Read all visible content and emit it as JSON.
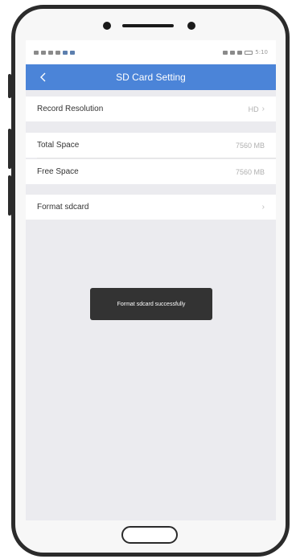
{
  "status_bar": {
    "time": "5:10"
  },
  "header": {
    "title": "SD Card Setting"
  },
  "settings": {
    "record_resolution": {
      "label": "Record Resolution",
      "value": "HD"
    },
    "total_space": {
      "label": "Total Space",
      "value": "7560 MB"
    },
    "free_space": {
      "label": "Free Space",
      "value": "7560 MB"
    },
    "format_sdcard": {
      "label": "Format sdcard"
    }
  },
  "toast": {
    "message": "Format sdcard successfully"
  },
  "icons": {
    "back": "chevron-left-icon",
    "chevron": "chevron-right-icon"
  },
  "colors": {
    "header": "#4b84d8",
    "background": "#ebebef",
    "toast": "#333333"
  }
}
